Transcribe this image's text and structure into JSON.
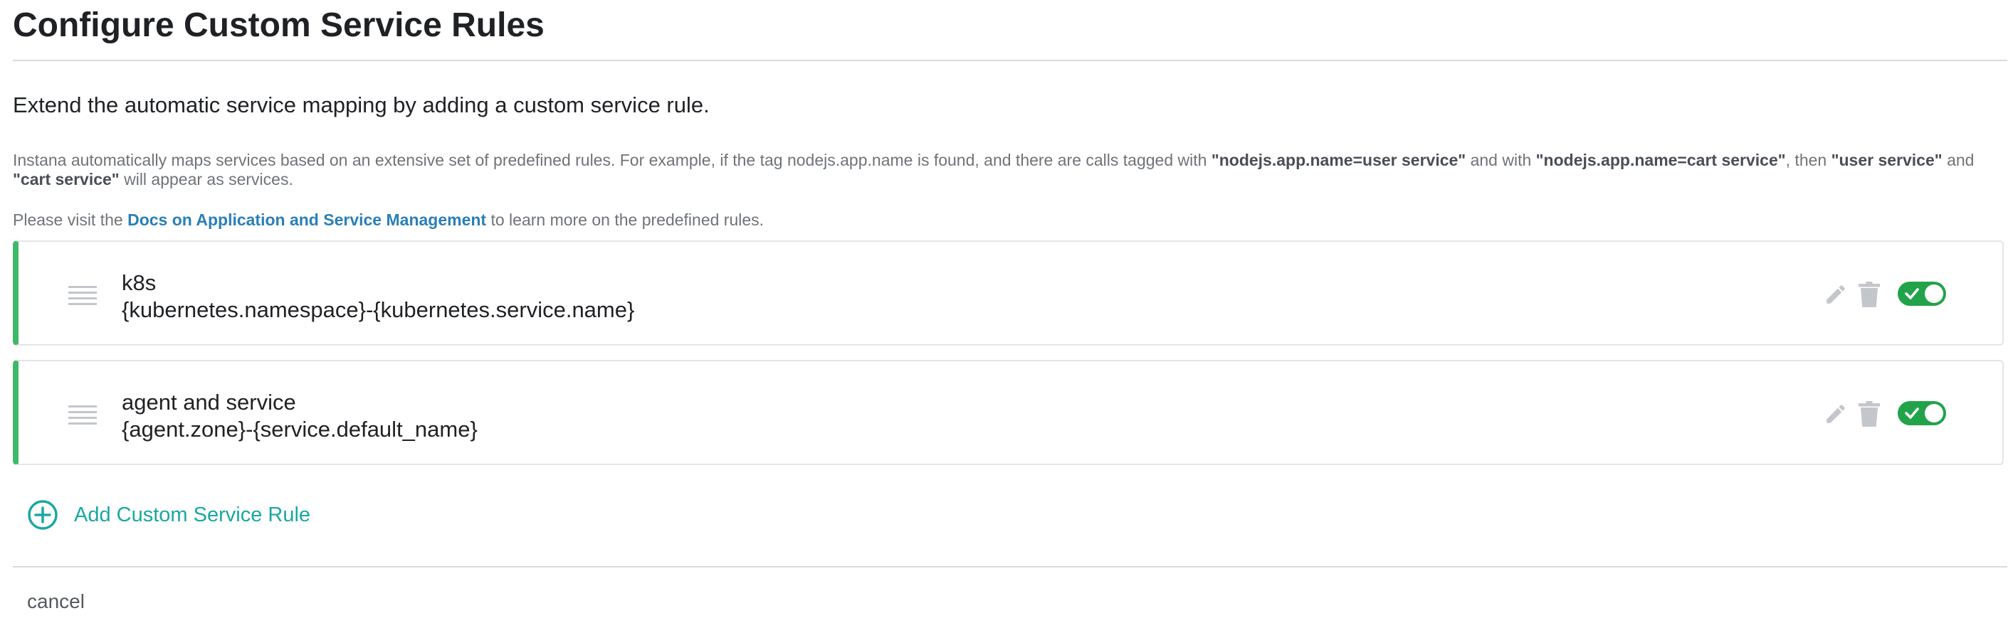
{
  "page": {
    "title": "Configure Custom Service Rules",
    "subtitle": "Extend the automatic service mapping by adding a custom service rule."
  },
  "intro": {
    "part1": "Instana automatically maps services based on an extensive set of predefined rules. For example, if the tag nodejs.app.name is found, and there are calls tagged with ",
    "bold1": "\"nodejs.app.name=user service\"",
    "part2": " and with ",
    "bold2": "\"nodejs.app.name=cart service\"",
    "part3": ", then ",
    "bold3": "\"user service\"",
    "part4": " and ",
    "bold4": "\"cart service\"",
    "part5": " will appear as services."
  },
  "docs": {
    "prefix": "Please visit the ",
    "link_label": "Docs on Application and Service Management",
    "suffix": " to learn more on the predefined rules."
  },
  "rules": [
    {
      "name": "k8s",
      "template": "{kubernetes.namespace}-{kubernetes.service.name}",
      "enabled": true
    },
    {
      "name": "agent and service",
      "template": "{agent.zone}-{service.default_name}",
      "enabled": true
    }
  ],
  "actions": {
    "add_rule_label": "Add Custom Service Rule",
    "cancel_label": "cancel"
  },
  "icons": {
    "drag": "drag-handle-icon",
    "edit": "pencil-icon",
    "delete": "trash-icon",
    "toggle_check": "check-icon",
    "add": "plus-circle-icon"
  },
  "colors": {
    "accent_teal": "#1aa8a0",
    "link_blue": "#2a7fb7",
    "rule_border_green": "#3fb86a",
    "toggle_on_green": "#22a34a",
    "icon_gray": "#c3c6ca"
  }
}
